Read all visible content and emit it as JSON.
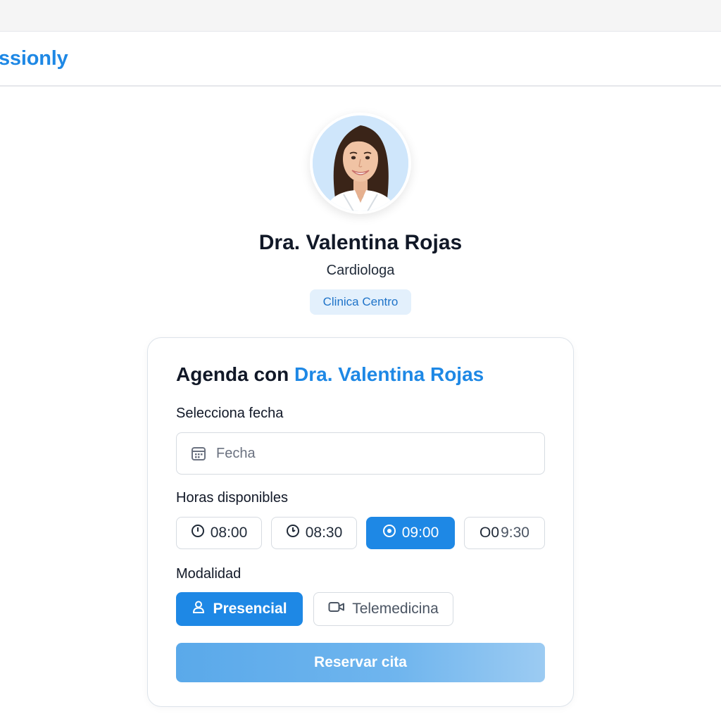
{
  "app": {
    "brand": "ssionly"
  },
  "doctor": {
    "name": "Dra. Valentina Rojas",
    "specialty": "Cardiologa",
    "clinic": "Clinica Centro"
  },
  "booking": {
    "title_prefix": "Agenda con",
    "title_doctor": "Dra. Valentina Rojas",
    "date_label": "Selecciona fecha",
    "date_placeholder": "Fecha",
    "hours_label": "Horas disponibles",
    "slots": [
      {
        "label": "08:00",
        "selected": false
      },
      {
        "label": "08:30",
        "selected": false
      },
      {
        "label": "09:00",
        "selected": true
      },
      {
        "label": "9:30",
        "prefix": "O0",
        "selected": false
      }
    ],
    "modality_label": "Modalidad",
    "modalities": [
      {
        "label": "Presencial",
        "selected": true,
        "icon": "person-icon"
      },
      {
        "label": "Telemedicina",
        "selected": false,
        "icon": "video-icon"
      }
    ],
    "submit_label": "Reservar cita"
  },
  "colors": {
    "accent": "#1e88e5",
    "badge_bg": "#e3f0fc",
    "badge_text": "#1e73c9"
  }
}
